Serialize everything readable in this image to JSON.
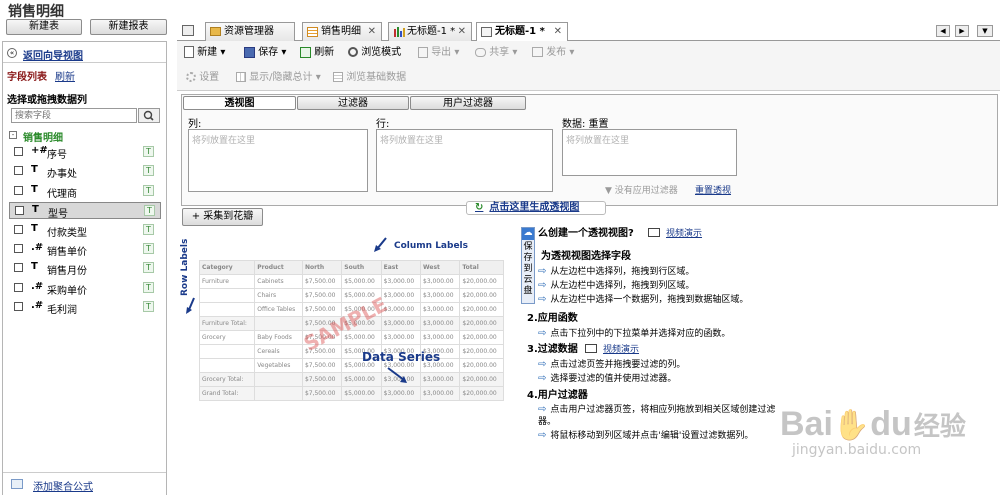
{
  "app": {
    "title": "销售明细"
  },
  "left": {
    "new_table": "新建表",
    "new_report": "新建报表",
    "back_link": "返回向导视图",
    "field_list": "字段列表",
    "refresh": "刷新",
    "choose_label": "选择或拖拽数据列",
    "search_placeholder": "搜索字段",
    "group": "销售明细",
    "fields": [
      {
        "type": "+#",
        "name": "序号"
      },
      {
        "type": "T",
        "name": "办事处"
      },
      {
        "type": "T",
        "name": "代理商"
      },
      {
        "type": "T",
        "name": "型号"
      },
      {
        "type": "T",
        "name": "付款类型"
      },
      {
        "type": ".#",
        "name": "销售单价"
      },
      {
        "type": "T",
        "name": "销售月份"
      },
      {
        "type": ".#",
        "name": "采购单价"
      },
      {
        "type": ".#",
        "name": "毛利润"
      }
    ],
    "add_formula": "添加聚合公式"
  },
  "tabs": [
    {
      "label": "资源管理器"
    },
    {
      "label": "销售明细"
    },
    {
      "label": "无标题-1 *"
    },
    {
      "label": "无标题-1 *"
    }
  ],
  "toolbar": {
    "new": "新建",
    "save": "保存",
    "refresh": "刷新",
    "browse": "浏览模式",
    "export": "导出",
    "share": "共享",
    "publish": "发布",
    "settings": "设置",
    "show_hide": "显示/隐藏总计",
    "browse_data": "浏览基础数据"
  },
  "pivot": {
    "tab_pivot": "透视图",
    "tab_filter": "过滤器",
    "tab_user_filter": "用户过滤器",
    "col_label": "列:",
    "row_label": "行:",
    "data_label": "数据: 重置",
    "col_ph": "将列放置在这里",
    "row_ph": "将列放置在这里",
    "data_ph": "将列放置在这里",
    "apply_filter": "没有应用过滤器",
    "reset_pivot": "重置透视",
    "generate": "点击这里生成透视图",
    "collect": "采集到花瓣"
  },
  "sample": {
    "column_labels": "Column Labels",
    "row_labels": "Row Labels",
    "data_series": "Data Series",
    "watermark": "SAMPLE",
    "headers": [
      "Category",
      "Product",
      "North",
      "South",
      "East",
      "West",
      "Total"
    ],
    "rows": [
      [
        "Furniture",
        "Cabinets",
        "$7,500.00",
        "$5,000.00",
        "$3,000.00",
        "$3,000.00",
        "$20,000.00"
      ],
      [
        "",
        "Chairs",
        "$7,500.00",
        "$5,000.00",
        "$3,000.00",
        "$3,000.00",
        "$20,000.00"
      ],
      [
        "",
        "Office Tables",
        "$7,500.00",
        "$5,000.00",
        "$3,000.00",
        "$3,000.00",
        "$20,000.00"
      ],
      [
        "Furniture Total:",
        "",
        "$7,500.00",
        "$5,000.00",
        "$3,000.00",
        "$3,000.00",
        "$20,000.00"
      ],
      [
        "Grocery",
        "Baby Foods",
        "$7,500.00",
        "$5,000.00",
        "$3,000.00",
        "$3,000.00",
        "$20,000.00"
      ],
      [
        "",
        "Cereals",
        "$7,500.00",
        "$5,000.00",
        "$3,000.00",
        "$3,000.00",
        "$20,000.00"
      ],
      [
        "",
        "Vegetables",
        "$7,500.00",
        "$5,000.00",
        "$3,000.00",
        "$3,000.00",
        "$20,000.00"
      ],
      [
        "Grocery Total:",
        "",
        "$7,500.00",
        "$5,000.00",
        "$3,000.00",
        "$3,000.00",
        "$20,000.00"
      ],
      [
        "Grand Total:",
        "",
        "$7,500.00",
        "$5,000.00",
        "$3,000.00",
        "$3,000.00",
        "$20,000.00"
      ]
    ]
  },
  "help": {
    "title": "么创建一个透视视图?",
    "video": "视频演示",
    "side_tab": "保存到云盘",
    "s1": "为透视视图选择字段",
    "s1_items": [
      "从左边栏中选择列，拖拽到行区域。",
      "从左边栏中选择列，拖拽到列区域。",
      "从左边栏中选择一个数据列，拖拽到数据轴区域。"
    ],
    "s2": "2.应用函数",
    "s2_items": [
      "点击下拉列中的下拉菜单并选择对应的函数。"
    ],
    "s3": "3.过滤数据",
    "s3_video": "视频演示",
    "s3_items": [
      "点击过滤页签并拖拽要过滤的列。",
      "选择要过滤的值并使用过滤器。"
    ],
    "s4": "4.用户过滤器",
    "s4_items": [
      "点击用户过滤器页签，将相应列拖放到相关区域创建过滤器。",
      "将鼠标移动到列区域并点击'编辑'设置过滤数据列。"
    ]
  },
  "watermark": {
    "brand": "Bai",
    "paw": "du",
    "cn": "经验",
    "url": "jingyan.baidu.com"
  }
}
